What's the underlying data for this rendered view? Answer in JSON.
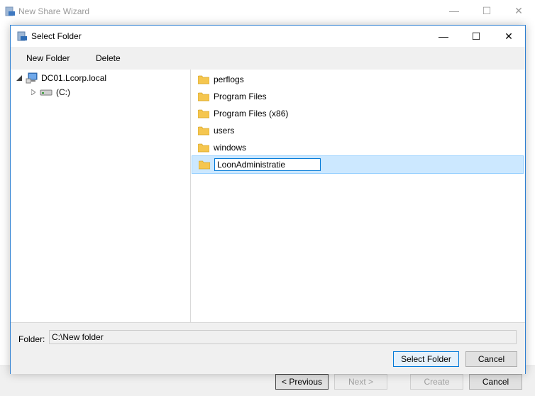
{
  "wizard": {
    "title": "New Share Wizard",
    "buttons": {
      "previous": "< Previous",
      "next": "Next >",
      "create": "Create",
      "cancel": "Cancel"
    }
  },
  "dialog": {
    "title": "Select Folder",
    "toolbar": {
      "new_folder": "New Folder",
      "delete": "Delete"
    },
    "tree": {
      "server": "DC01.Lcorp.local",
      "drive": "(C:)"
    },
    "list": {
      "items": [
        "perflogs",
        "Program Files",
        "Program Files (x86)",
        "users",
        "windows"
      ],
      "renaming_value": "LoonAdministratie"
    },
    "folder_label": "Folder:",
    "folder_value": "C:\\New folder",
    "buttons": {
      "select_folder": "Select Folder",
      "cancel": "Cancel"
    }
  },
  "colors": {
    "accent": "#0078d7",
    "selection": "#cce8ff",
    "folder": "#f5c64f"
  }
}
